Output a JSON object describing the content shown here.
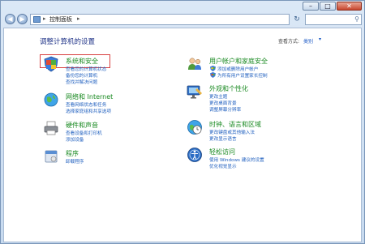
{
  "window": {
    "minimize_label": "–",
    "maximize_label": "□",
    "close_label": "✕"
  },
  "toolbar": {
    "back": "◀",
    "forward": "▶",
    "breadcrumb": [
      "控制面板"
    ],
    "separator": "▸",
    "refresh": "↻",
    "search_icon": "⚲"
  },
  "main": {
    "heading": "调整计算机的设置",
    "view_by_label": "查看方式:",
    "view_by_value": "类别",
    "view_by_arrow": "▾"
  },
  "categories": [
    {
      "title": "系统和安全",
      "links": [
        "查看您的计算机状态",
        "备份您的计算机",
        "查找并解决问题"
      ],
      "icon": "shield-flag-icon"
    },
    {
      "title": "网络和 Internet",
      "links": [
        "查看网络状态和任务",
        "选择家庭组和共享选项"
      ],
      "icon": "network-globe-icon"
    },
    {
      "title": "硬件和声音",
      "links": [
        "查看设备和打印机",
        "添加设备"
      ],
      "icon": "printer-icon"
    },
    {
      "title": "程序",
      "links": [
        "卸载程序"
      ],
      "icon": "programs-icon"
    },
    {
      "title": "用户帐户和家庭安全",
      "links": [
        "添加或删除用户帐户",
        "为所有用户设置家长控制"
      ],
      "icon": "users-icon"
    },
    {
      "title": "外观和个性化",
      "links": [
        "更改主题",
        "更改桌面背景",
        "调整屏幕分辨率"
      ],
      "icon": "monitor-icon"
    },
    {
      "title": "时钟、语言和区域",
      "links": [
        "更改键盘或其他输入法",
        "更改显示语言"
      ],
      "icon": "clock-globe-icon"
    },
    {
      "title": "轻松访问",
      "links": [
        "使用 Windows 建议的设置",
        "优化视觉显示"
      ],
      "icon": "accessibility-icon"
    }
  ]
}
